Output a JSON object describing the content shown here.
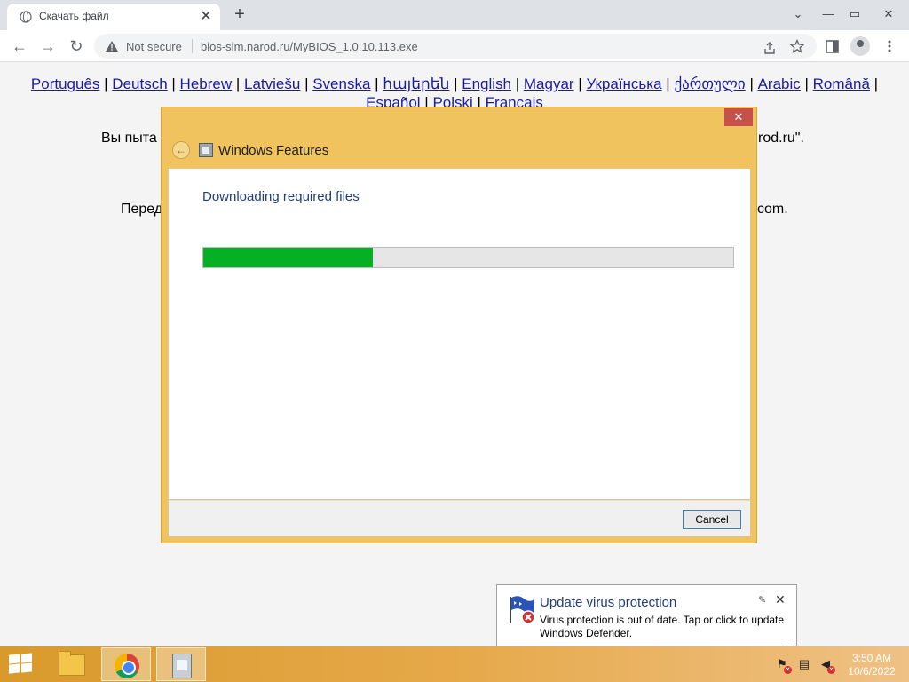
{
  "browser": {
    "tab_title": "Скачать файл",
    "tab_close": "✕",
    "new_tab": "+",
    "security_label": "Not secure",
    "url": "bios-sim.narod.ru/MyBIOS_1.0.10.113.exe",
    "window_controls": {
      "minimize": "⌄",
      "restore": "▭",
      "separator": "—",
      "close": "✕"
    },
    "nav_icons": {
      "back": "←",
      "forward": "→",
      "reload": "↻"
    },
    "toolbar_icons": [
      "share-icon",
      "star-icon",
      "side-panel-icon",
      "profile-icon",
      "menu-icon"
    ]
  },
  "page": {
    "languages": [
      "Português",
      "Deutsch",
      "Hebrew",
      "Latviešu",
      "Svenska",
      "հայերեն",
      "English",
      "Magyar",
      "Українська",
      "ქართული",
      "Arabic",
      "Română",
      "Español",
      "Polski",
      "Français"
    ],
    "text_fragments": {
      "line1_start": "Вы пыта",
      "line1_end": "rod.ru\".",
      "line2_start": "Перед",
      "line2_end": "com."
    },
    "link_color": "#1a1aa6"
  },
  "dialog": {
    "title": "Windows Features",
    "heading": "Downloading required files",
    "progress_fraction": 0.32,
    "cancel_label": "Cancel",
    "close_glyph": "✕",
    "back_glyph": "←",
    "accent_color": "#f0c35e",
    "progress_color": "#06b025"
  },
  "notification": {
    "title": "Update virus protection",
    "message": "Virus protection is out of date. Tap or click to update Windows Defender.",
    "pin_glyph": "✎",
    "close_glyph": "✕"
  },
  "taskbar": {
    "apps": [
      "file-explorer",
      "google-chrome",
      "windows-features"
    ],
    "tray": [
      "action-center-icon",
      "network-icon",
      "volume-muted-icon"
    ],
    "time": "3:50 AM",
    "date": "10/6/2022"
  }
}
